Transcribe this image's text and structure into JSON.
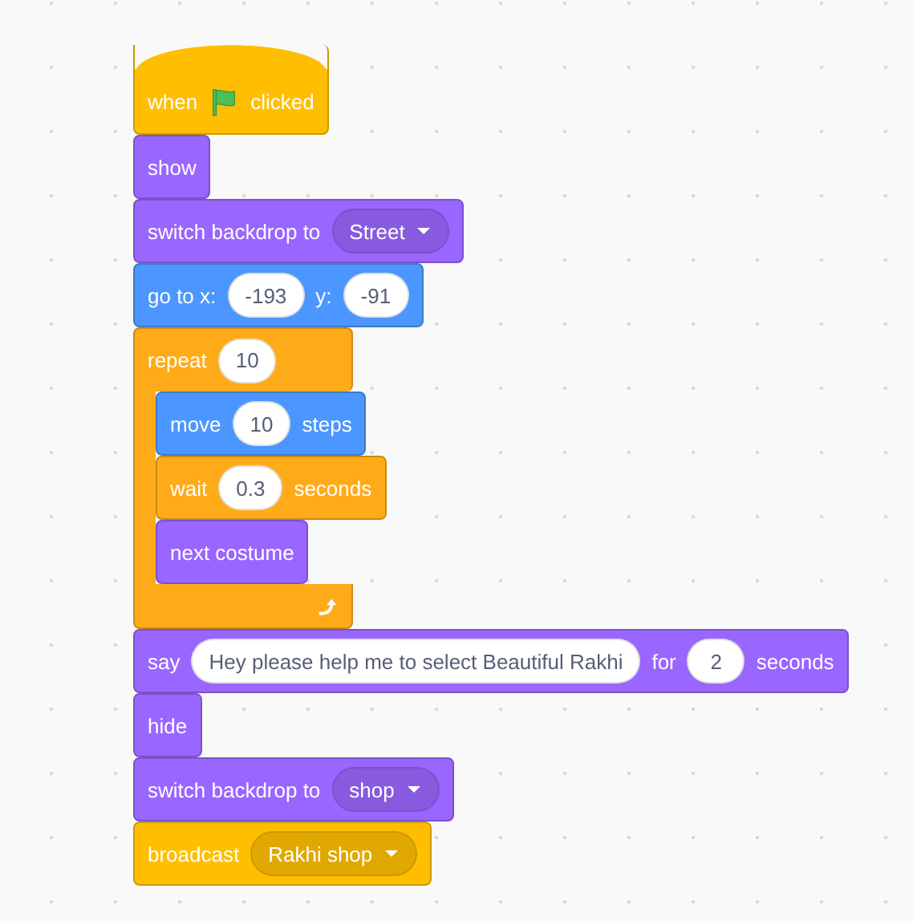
{
  "script": {
    "blocks": [
      {
        "kind": "hat",
        "color": "#ffbf00",
        "parts": [
          {
            "kind": "label",
            "text": "when"
          },
          {
            "kind": "flag"
          },
          {
            "kind": "label",
            "text": "clicked"
          }
        ]
      },
      {
        "kind": "stack",
        "color": "#9966ff",
        "parts": [
          {
            "kind": "label",
            "text": "show"
          }
        ]
      },
      {
        "kind": "stack",
        "color": "#9966ff",
        "parts": [
          {
            "kind": "label",
            "text": "switch backdrop to"
          },
          {
            "kind": "dropdown",
            "text": "Street"
          }
        ]
      },
      {
        "kind": "stack",
        "color": "#4c97ff",
        "parts": [
          {
            "kind": "label",
            "text": "go to x:"
          },
          {
            "kind": "number",
            "text": "-193"
          },
          {
            "kind": "label",
            "text": "y:"
          },
          {
            "kind": "number",
            "text": "-91"
          }
        ]
      },
      {
        "kind": "c",
        "color": "#ffab19",
        "parts": [
          {
            "kind": "label",
            "text": "repeat"
          },
          {
            "kind": "number",
            "text": "10"
          }
        ],
        "children": [
          {
            "kind": "stack",
            "color": "#4c97ff",
            "parts": [
              {
                "kind": "label",
                "text": "move"
              },
              {
                "kind": "number",
                "text": "10"
              },
              {
                "kind": "label",
                "text": "steps"
              }
            ]
          },
          {
            "kind": "stack",
            "color": "#ffab19",
            "parts": [
              {
                "kind": "label",
                "text": "wait"
              },
              {
                "kind": "number",
                "text": "0.3"
              },
              {
                "kind": "label",
                "text": "seconds"
              }
            ]
          },
          {
            "kind": "stack",
            "color": "#9966ff",
            "parts": [
              {
                "kind": "label",
                "text": "next costume"
              }
            ]
          }
        ]
      },
      {
        "kind": "stack",
        "color": "#9966ff",
        "parts": [
          {
            "kind": "label",
            "text": "say"
          },
          {
            "kind": "text",
            "text": "Hey please help me to select Beautiful Rakhi"
          },
          {
            "kind": "label",
            "text": "for"
          },
          {
            "kind": "number",
            "text": "2"
          },
          {
            "kind": "label",
            "text": "seconds"
          }
        ]
      },
      {
        "kind": "stack",
        "color": "#9966ff",
        "parts": [
          {
            "kind": "label",
            "text": "hide"
          }
        ]
      },
      {
        "kind": "stack",
        "color": "#9966ff",
        "parts": [
          {
            "kind": "label",
            "text": "switch backdrop to"
          },
          {
            "kind": "dropdown",
            "text": "shop"
          }
        ]
      },
      {
        "kind": "stack",
        "color": "#ffbf00",
        "parts": [
          {
            "kind": "label",
            "text": "broadcast"
          },
          {
            "kind": "dropdown",
            "text": "Rakhi shop"
          }
        ]
      }
    ]
  }
}
